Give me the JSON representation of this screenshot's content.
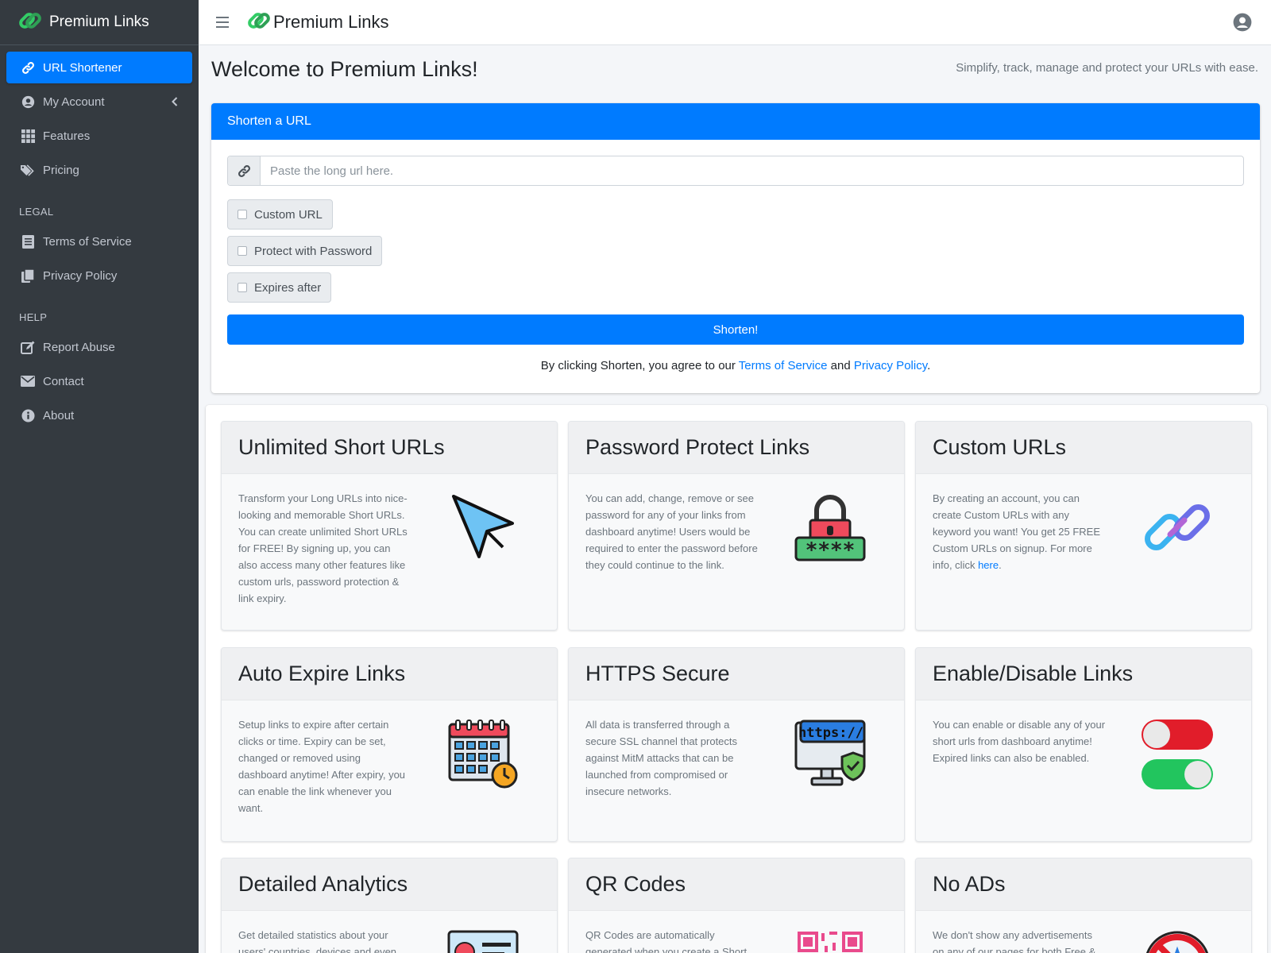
{
  "brand": {
    "name": "Premium Links"
  },
  "sidebar": {
    "items": [
      {
        "label": "URL Shortener",
        "icon": "link-icon",
        "active": true
      },
      {
        "label": "My Account",
        "icon": "user-circle-icon"
      },
      {
        "label": "Features",
        "icon": "grid-icon"
      },
      {
        "label": "Pricing",
        "icon": "tags-icon"
      }
    ],
    "legal_header": "LEGAL",
    "legal": [
      {
        "label": "Terms of Service",
        "icon": "book-icon"
      },
      {
        "label": "Privacy Policy",
        "icon": "copy-icon"
      }
    ],
    "help_header": "HELP",
    "help": [
      {
        "label": "Report Abuse",
        "icon": "edit-icon"
      },
      {
        "label": "Contact",
        "icon": "envelope-icon"
      },
      {
        "label": "About",
        "icon": "info-icon"
      }
    ]
  },
  "topbar": {
    "title": "Premium Links"
  },
  "content": {
    "title": "Welcome to Premium Links!",
    "tagline": "Simplify, track, manage and protect your URLs with ease."
  },
  "shorten": {
    "header": "Shorten a URL",
    "placeholder": "Paste the long url here.",
    "option_custom": "Custom URL",
    "option_password": "Protect with Password",
    "option_expires": "Expires after",
    "button": "Shorten!",
    "agree_prefix": "By clicking Shorten, you agree to our ",
    "agree_tos": "Terms of Service",
    "agree_and": " and ",
    "agree_privacy": "Privacy Policy",
    "agree_suffix": "."
  },
  "features": [
    {
      "title": "Unlimited Short URLs",
      "text": "Transform your Long URLs into nice-looking and memorable Short URLs. You can create unlimited Short URLs for FREE! By signing up, you can also access many other features like custom urls, password protection & link expiry.",
      "icon": "cursor-icon"
    },
    {
      "title": "Password Protect Links",
      "text": "You can add, change, remove or see password for any of your links from dashboard anytime! Users would be required to enter the password before they could continue to the link.",
      "icon": "padlock-icon"
    },
    {
      "title": "Custom URLs",
      "text": "By creating an account, you can create Custom URLs with any keyword you want! You get 25 FREE Custom URLs on signup. For more info, click ",
      "link": "here",
      "suffix": ".",
      "icon": "chain-icon"
    },
    {
      "title": "Auto Expire Links",
      "text": "Setup links to expire after certain clicks or time. Expiry can be set, changed or removed using dashboard anytime! After expiry, you can enable the link whenever you want.",
      "icon": "calendar-icon"
    },
    {
      "title": "HTTPS Secure",
      "text": "All data is transferred through a secure SSL channel that protects against MitM attacks that can be launched from compromised or insecure networks.",
      "icon": "https-monitor-icon",
      "icon_text": "https://"
    },
    {
      "title": "Enable/Disable Links",
      "text": "You can enable or disable any of your short urls from dashboard anytime! Expired links can also be enabled.",
      "icon": "toggle-icon"
    },
    {
      "title": "Detailed Analytics",
      "text": "Get detailed statistics about your users' countries, devices and even",
      "icon": "analytics-icon"
    },
    {
      "title": "QR Codes",
      "text": "QR Codes are automatically generated when you create a Short",
      "icon": "qr-icon"
    },
    {
      "title": "No ADs",
      "text": "We don't show any advertisements on any of our pages for both Free &",
      "icon": "no-ads-icon"
    }
  ],
  "colors": {
    "primary": "#007bff",
    "sidebar": "#343a40",
    "sidebar_text": "#c2c7d0",
    "background": "#f4f6f9"
  }
}
